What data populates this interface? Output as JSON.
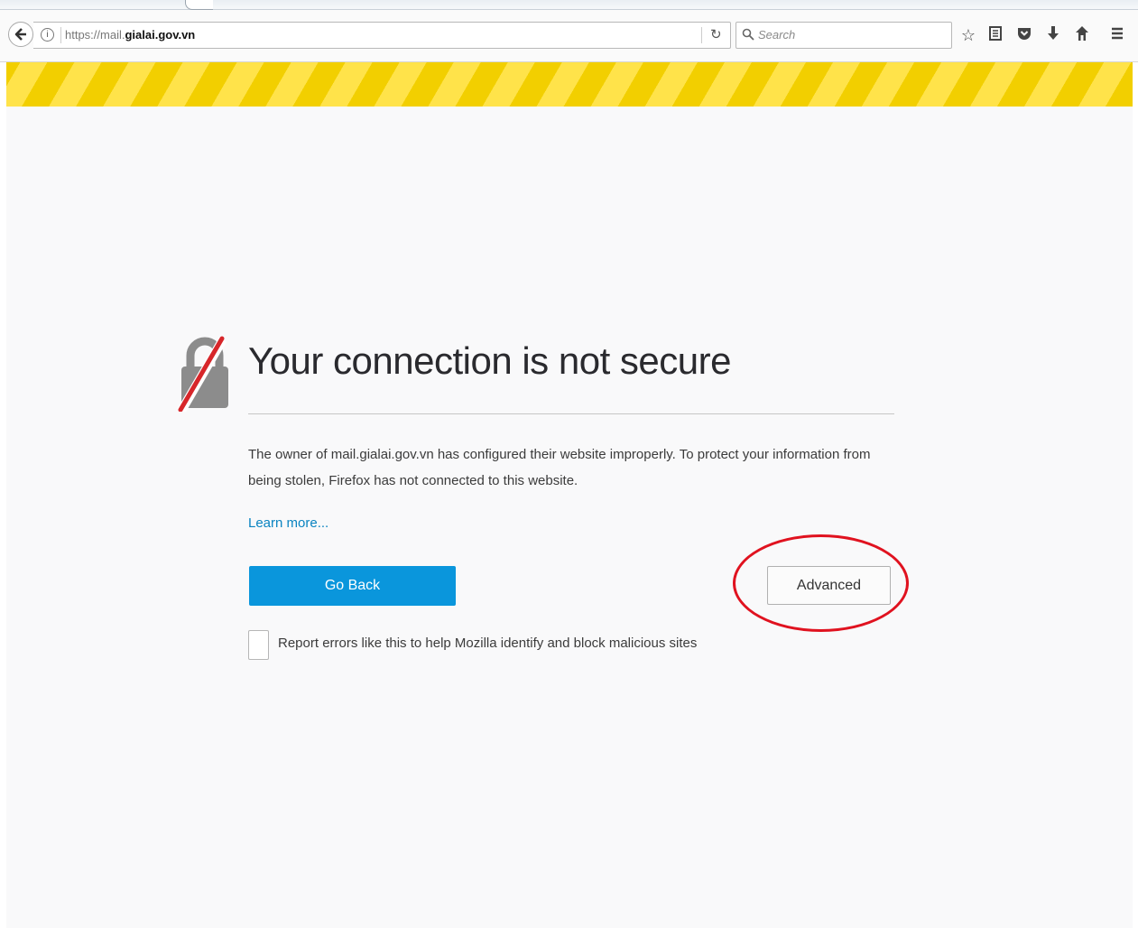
{
  "browser": {
    "url_scheme": "https://mail.",
    "url_host": "gialai.gov.vn",
    "search_placeholder": "Search",
    "icons": [
      "back-arrow-icon",
      "info-icon",
      "reload-icon",
      "search-icon",
      "bookmark-star-icon",
      "reading-list-icon",
      "pocket-icon",
      "download-icon",
      "home-icon",
      "menu-icon"
    ]
  },
  "error_page": {
    "title": "Your connection is not secure",
    "description": "The owner of mail.gialai.gov.vn has configured their website improperly. To protect your information from being stolen, Firefox has not connected to this website.",
    "learn_more": "Learn more...",
    "go_back_label": "Go Back",
    "advanced_label": "Advanced",
    "report_label": "Report errors like this to help Mozilla identify and block malicious sites",
    "report_checked": false
  },
  "colors": {
    "warning_stripe": "#f2cf00",
    "primary_button": "#0a96dc",
    "link": "#0a84c1",
    "annotation_ring": "#e0121f"
  }
}
